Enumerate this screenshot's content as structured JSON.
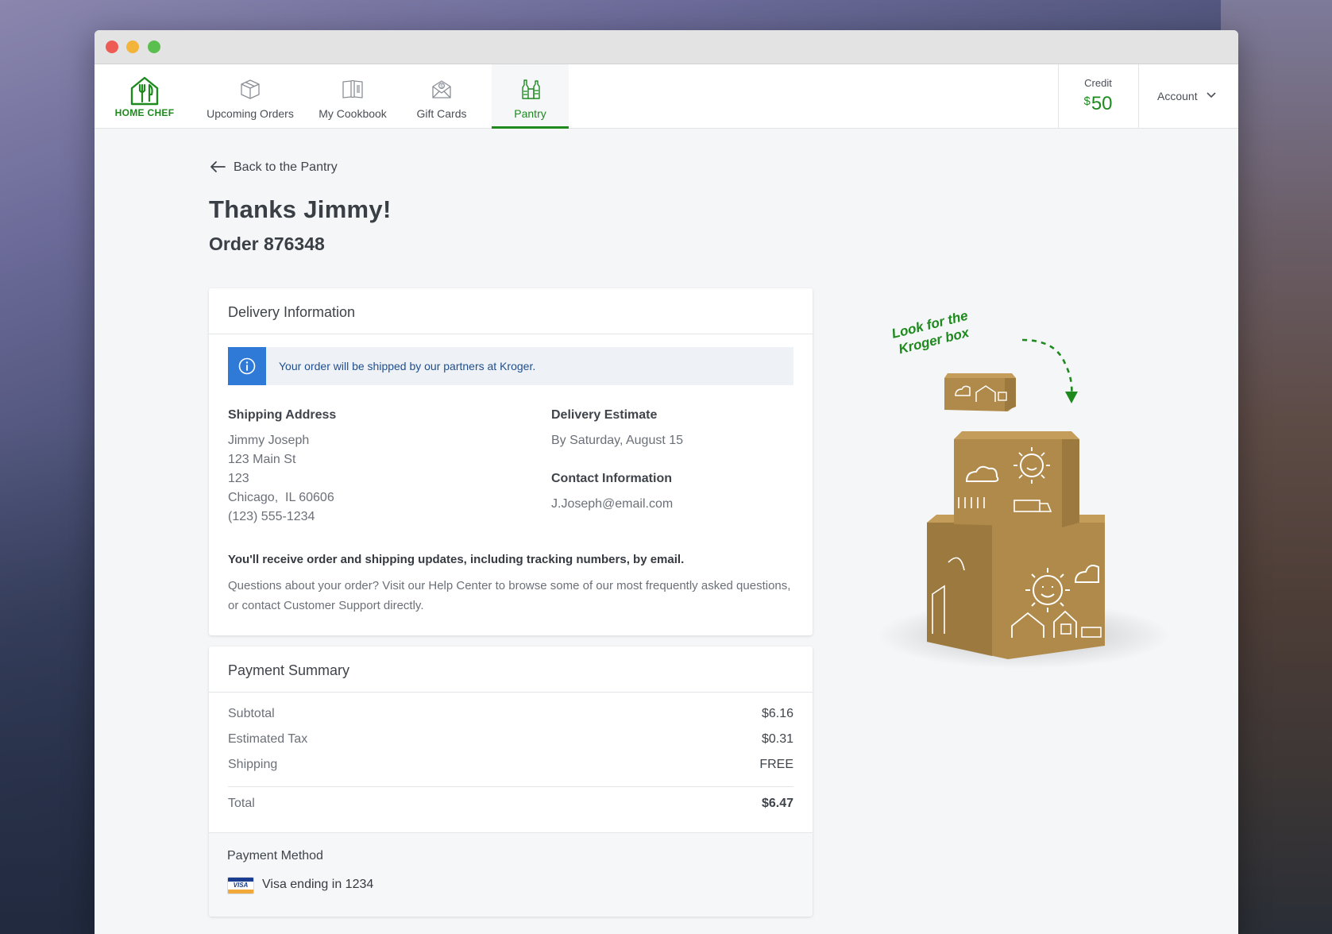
{
  "app": {
    "brand": "HOME CHEF",
    "accent": "#1e8a1e"
  },
  "nav": {
    "items": [
      {
        "label": "Upcoming Orders",
        "icon": "box-icon"
      },
      {
        "label": "My Cookbook",
        "icon": "book-icon"
      },
      {
        "label": "Gift Cards",
        "icon": "gift-card-icon"
      },
      {
        "label": "Pantry",
        "icon": "pantry-icon",
        "active": true
      }
    ],
    "credit_label": "Credit",
    "credit_currency": "$",
    "credit_amount": "50",
    "account_label": "Account"
  },
  "page": {
    "back_label": "Back to the Pantry",
    "title": "Thanks Jimmy!",
    "order": "Order 876348"
  },
  "delivery": {
    "heading": "Delivery Information",
    "banner": "Your order will be shipped by our partners at Kroger.",
    "shipping_label": "Shipping Address",
    "address_lines": [
      "Jimmy Joseph",
      "123 Main St",
      "123",
      "Chicago,  IL 60606",
      "(123) 555-1234"
    ],
    "estimate_label": "Delivery Estimate",
    "estimate_value": "By Saturday, August 15",
    "contact_label": "Contact Information",
    "contact_value": "J.Joseph@email.com",
    "note_bold": "You'll receive order and shipping updates, including tracking numbers, by email.",
    "note_text": "Questions about your order? Visit our Help Center to browse some of our most frequently asked questions, or contact Customer Support directly."
  },
  "payment": {
    "heading": "Payment Summary",
    "rows": [
      {
        "label": "Subtotal",
        "value": "$6.16"
      },
      {
        "label": "Estimated Tax",
        "value": "$0.31"
      },
      {
        "label": "Shipping",
        "value": "FREE"
      }
    ],
    "total_label": "Total",
    "total_value": "$6.47",
    "method_label": "Payment Method",
    "card_brand": "VISA",
    "card_text": "Visa ending in 1234"
  },
  "illustration": {
    "callout_line1": "Look for the",
    "callout_line2": "Kroger box"
  }
}
